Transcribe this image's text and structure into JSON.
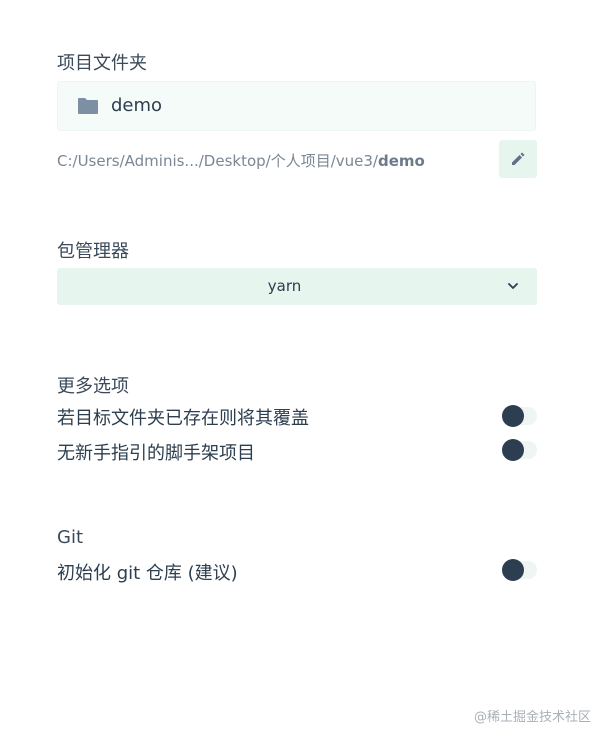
{
  "project_folder": {
    "title": "项目文件夹",
    "folder_name": "demo",
    "path_prefix": "C:/Users/Adminis.../Desktop/个人项目/vue3/",
    "path_last": "demo"
  },
  "package_manager": {
    "title": "包管理器",
    "selected": "yarn"
  },
  "more_options": {
    "title": "更多选项",
    "options": [
      {
        "label": "若目标文件夹已存在则将其覆盖",
        "enabled": false
      },
      {
        "label": "无新手指引的脚手架项目",
        "enabled": false
      }
    ]
  },
  "git": {
    "title": "Git",
    "init_label": "初始化 git 仓库 (建议)",
    "enabled": false
  },
  "watermark": "@稀土掘金技术社区",
  "icons": {
    "folder": "folder-icon",
    "edit": "pencil-icon",
    "select_arrow": "chevron-down-icon"
  },
  "colors": {
    "accent_bg": "#e6f5ee",
    "text": "#2c3e50",
    "muted": "#7a8794"
  }
}
